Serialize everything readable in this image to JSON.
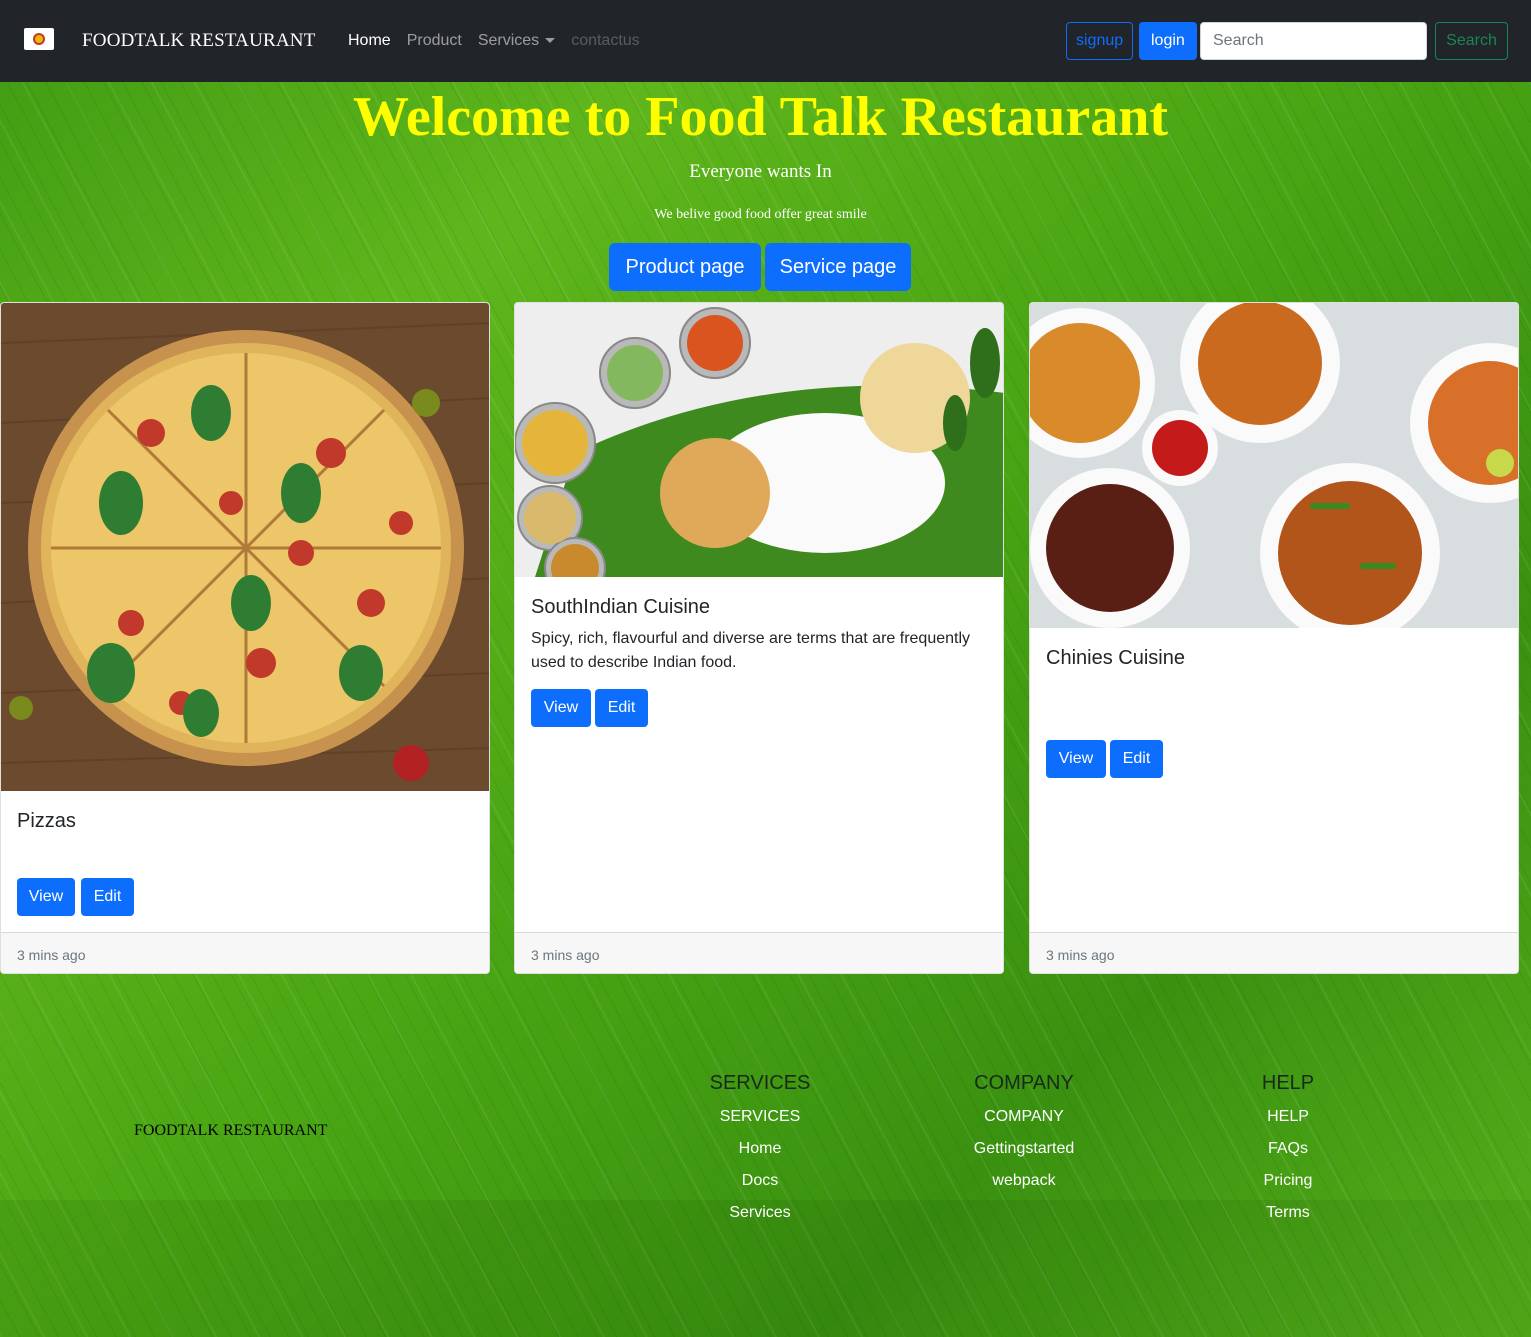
{
  "navbar": {
    "brand": "FOODTALK RESTAURANT",
    "links": [
      {
        "label": "Home"
      },
      {
        "label": "Product"
      },
      {
        "label": "Services"
      },
      {
        "label": "contactus"
      }
    ],
    "signup_label": "signup",
    "login_label": "login",
    "search_placeholder": "Search",
    "search_button": "Search"
  },
  "hero": {
    "title": "Welcome to Food Talk Restaurant",
    "subtitle": "Everyone wants In",
    "tagline": "We belive good food offer great smile",
    "product_button": "Product page",
    "service_button": "Service page"
  },
  "cards": [
    {
      "title": "Pizzas",
      "text": "",
      "view": "View",
      "edit": "Edit",
      "footer": "3 mins ago"
    },
    {
      "title": "SouthIndian Cuisine",
      "text": "Spicy, rich, flavourful and diverse are terms that are frequently used to describe Indian food.",
      "view": "View",
      "edit": "Edit",
      "footer": "3 mins ago"
    },
    {
      "title": "Chinies Cuisine",
      "text": "",
      "view": "View",
      "edit": "Edit",
      "footer": "3 mins ago"
    }
  ],
  "footer": {
    "brand": "FOODTALK RESTAURANT",
    "columns": [
      {
        "heading": "SERVICES",
        "links": [
          "SERVICES",
          "Home",
          "Docs",
          "Services"
        ]
      },
      {
        "heading": "COMPANY",
        "links": [
          "COMPANY",
          "Gettingstarted",
          "webpack"
        ]
      },
      {
        "heading": "HELP",
        "links": [
          "HELP",
          "FAQs",
          "Pricing",
          "Terms"
        ]
      }
    ]
  },
  "colors": {
    "navbar_bg": "#212529",
    "primary": "#0d6efd",
    "success": "#198754",
    "hero_title": "#ffff00",
    "leaf_green": "#4aa614"
  }
}
